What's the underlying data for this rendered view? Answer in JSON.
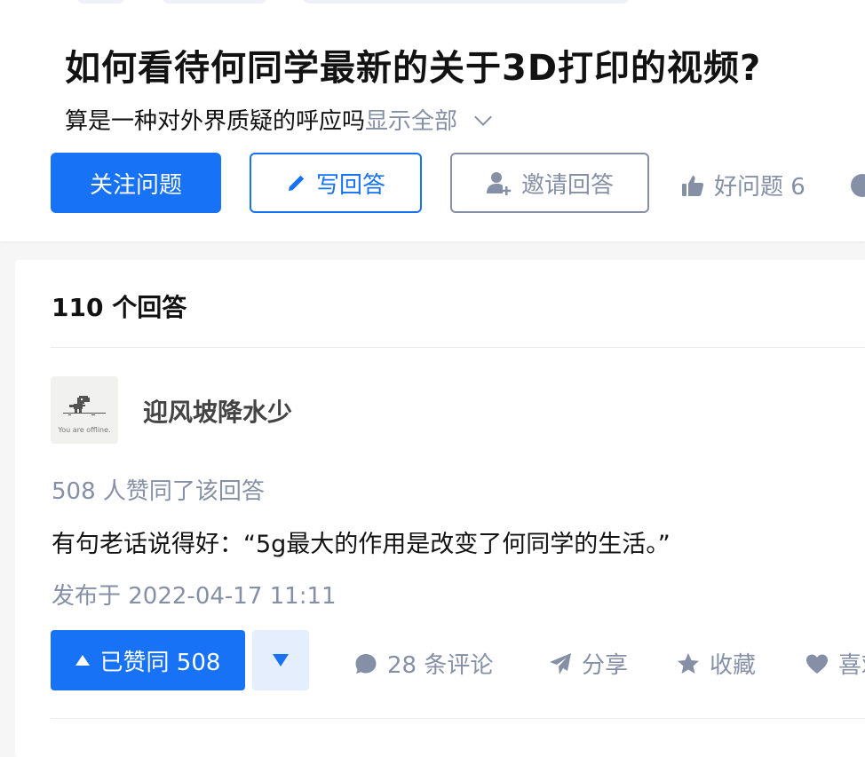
{
  "question": {
    "title": "如何看待何同学最新的关于3D打印的视频?",
    "description": "算是一种对外界质疑的呼应吗",
    "show_all_label": "显示全部",
    "actions": {
      "follow_label": "关注问题",
      "write_answer_label": "写回答",
      "invite_label": "邀请回答",
      "good_question_label": "好问题 6"
    }
  },
  "answers": {
    "count_label": "110 个回答",
    "items": [
      {
        "author": {
          "name": "迎风坡降水少",
          "avatar_caption": "You are offline."
        },
        "voters_label": "508 人赞同了该回答",
        "content": "有句老话说得好：“5g最大的作用是改变了何同学的生活。”",
        "published_label": "发布于 2022-04-17 11:11",
        "toolbar": {
          "upvote_label": "已赞同 508",
          "comments_label": "28 条评论",
          "share_label": "分享",
          "favorite_label": "收藏",
          "like_label": "喜欢"
        }
      }
    ]
  },
  "colors": {
    "brand_blue": "#1772f6",
    "muted_gray": "#8590a6",
    "text_dark": "#121212",
    "page_bg": "#f6f6f6"
  },
  "icons": {
    "write": "pencil-icon",
    "invite": "add-user-icon",
    "good_question": "thumb-up-icon",
    "comment": "comment-bubble-icon",
    "share": "paper-plane-icon",
    "favorite": "star-icon",
    "like": "heart-icon"
  }
}
